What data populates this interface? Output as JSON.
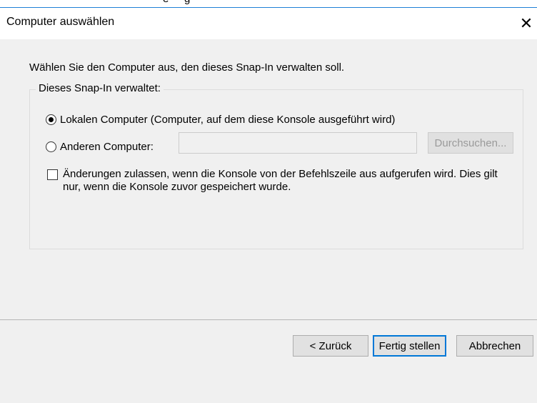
{
  "window": {
    "title": "Computer auswählen",
    "close_glyph": "✕"
  },
  "partial_top": {
    "text_left": "e ",
    "text_right": "g"
  },
  "dialog": {
    "intro": "Wählen Sie den Computer aus, den dieses Snap-In verwalten soll.",
    "group_label": "Dieses Snap-In verwaltet:",
    "radio_local": {
      "label": "Lokalen Computer (Computer, auf dem diese Konsole ausgeführt wird)",
      "checked": true
    },
    "radio_other": {
      "label": "Anderen Computer:",
      "checked": false
    },
    "other_computer_value": "",
    "browse_label": "Durchsuchen...",
    "checkbox": {
      "label": "Änderungen zulassen, wenn die Konsole von der Befehlszeile aus aufgerufen wird. Dies gilt nur, wenn die Konsole zuvor gespeichert wurde.",
      "checked": false
    }
  },
  "buttons": {
    "back": "< Zurück",
    "finish": "Fertig stellen",
    "cancel": "Abbrechen"
  },
  "colors": {
    "accent": "#0078d7",
    "window_bg": "#f0f0f0",
    "titlebar_bg": "#ffffff"
  }
}
